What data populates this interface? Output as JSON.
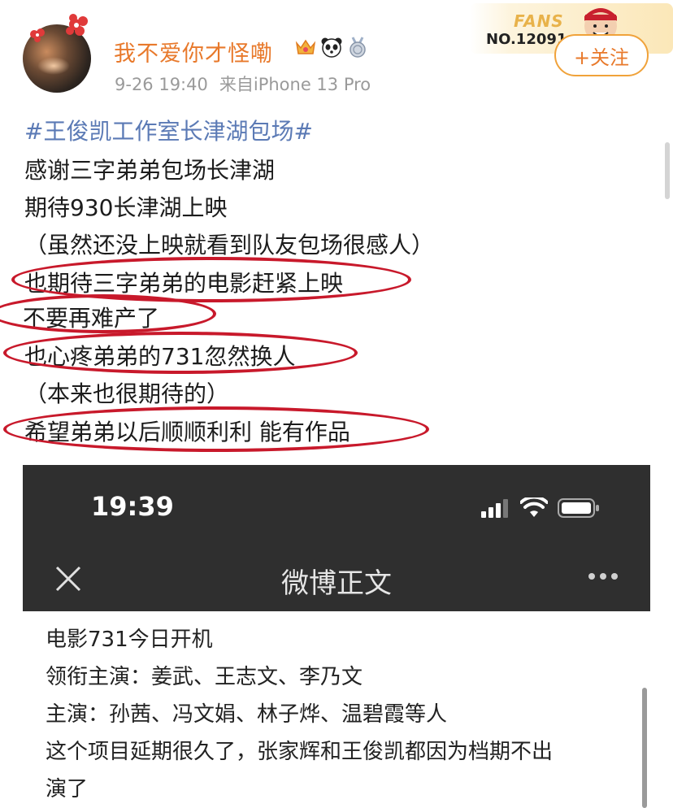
{
  "header": {
    "username": "我不爱你才怪嘞",
    "timestamp": "9-26 19:40",
    "source": "来自iPhone 13 Pro",
    "fans_label": "FANS",
    "fans_no": "NO.12091",
    "follow_label": "+关注"
  },
  "post": {
    "hashtag": "#王俊凯工作室长津湖包场#",
    "lines": [
      "感谢三字弟弟包场长津湖",
      "期待930长津湖上映",
      "（虽然还没上映就看到队友包场很感人）",
      "也期待三字弟弟的电影赶紧上映",
      "不要再难产了",
      "也心疼弟弟的731忽然换人",
      "（本来也很期待的）",
      "希望弟弟以后顺顺利利 能有作品"
    ]
  },
  "embedded": {
    "status_time": "19:39",
    "nav_title": "微博正文",
    "lines": [
      "电影731今日开机",
      "领衔主演：姜武、王志文、李乃文",
      "主演：孙茜、冯文娟、林子烨、温碧霞等人",
      "这个项目延期很久了，张家辉和王俊凯都因为档期不出",
      "演了"
    ]
  },
  "colors": {
    "username": "#e8792b",
    "hashtag": "#5b7ab5",
    "highlight_oval": "#c8192b",
    "follow_border": "#f0a23a"
  },
  "icons": {
    "badges": [
      "crown-icon",
      "panda-icon",
      "medal-icon"
    ],
    "status": [
      "signal-icon",
      "wifi-icon",
      "battery-icon"
    ],
    "nav": [
      "close-icon",
      "more-icon"
    ]
  }
}
